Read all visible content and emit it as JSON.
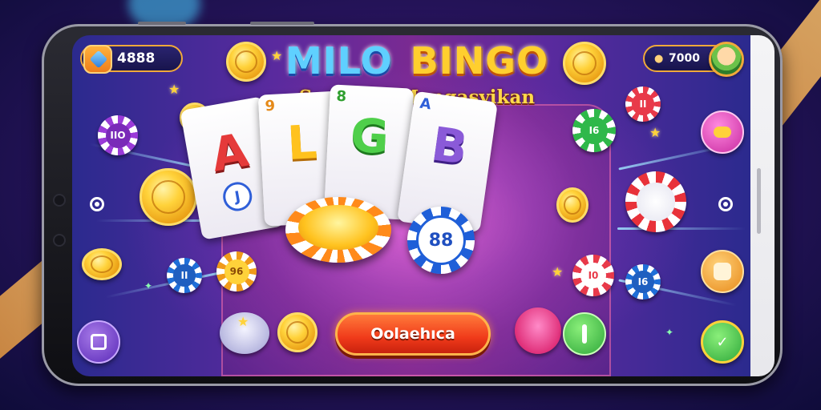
{
  "app": {
    "title_part1": "MILO",
    "title_part2": "BINGO",
    "subtitle": "Seru dan Mengasyikan"
  },
  "header": {
    "gems_value": "4888",
    "players_value": "7000"
  },
  "cards": [
    {
      "corner": "",
      "letter": "A",
      "sub": "J"
    },
    {
      "corner": "9",
      "letter": "L",
      "sub": ""
    },
    {
      "corner": "8",
      "letter": "G",
      "sub": ""
    },
    {
      "corner": "A",
      "letter": "B",
      "sub": "88"
    }
  ],
  "chips": {
    "top_left": "IIO",
    "mid_left": "II",
    "bottom_left": "96",
    "top_right": "II",
    "green_right": "I6",
    "red_right": "I0",
    "blue_right": "I6",
    "big_blue": "88"
  },
  "play_button": {
    "label": "Oolaehıca"
  },
  "colors": {
    "accent_orange": "#f0a93a",
    "play_red": "#f03a1a",
    "title_blue": "#5fd0ff",
    "title_yellow": "#ffcf2e"
  },
  "icons": [
    "gem-icon",
    "person-icon",
    "avatar",
    "ring-icon",
    "chat-icon",
    "share-icon",
    "settings-icon"
  ]
}
